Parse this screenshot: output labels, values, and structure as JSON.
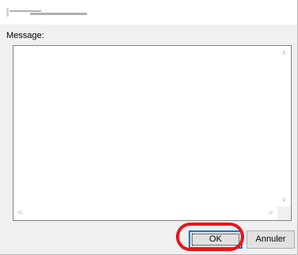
{
  "dialog": {
    "message_label": "Message:",
    "message_value": "",
    "ok_label": "OK",
    "cancel_label": "Annuler"
  },
  "icons": {
    "scroll_up": "scroll-up-arrow",
    "scroll_down": "scroll-down-arrow",
    "scroll_left": "scroll-left-arrow",
    "scroll_right": "scroll-right-arrow"
  },
  "colors": {
    "highlight": "#e8141b",
    "focus_border": "#0078d7"
  }
}
